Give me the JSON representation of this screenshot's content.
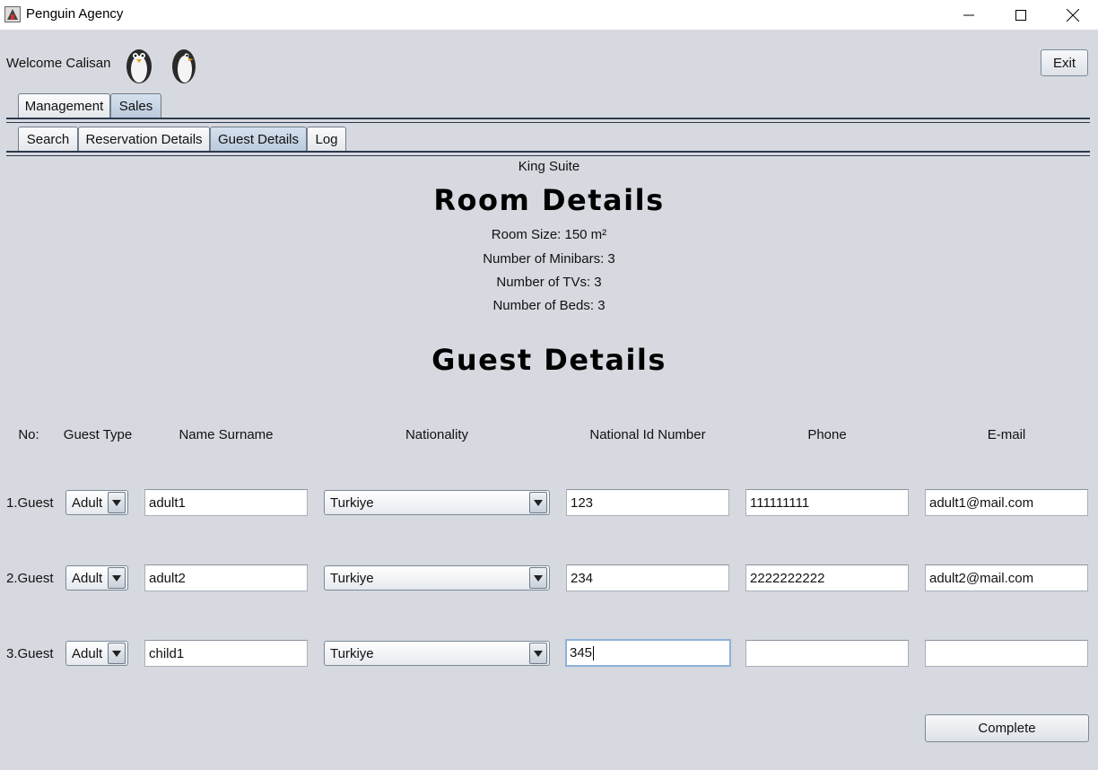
{
  "window": {
    "title": "Penguin Agency",
    "icon": "app-icon"
  },
  "header": {
    "welcome": "Welcome Calisan",
    "exit_label": "Exit"
  },
  "main_tabs": [
    {
      "label": "Management",
      "active": false
    },
    {
      "label": "Sales",
      "active": true
    }
  ],
  "sub_tabs": [
    {
      "label": "Search",
      "active": false
    },
    {
      "label": "Reservation Details",
      "active": false
    },
    {
      "label": "Guest Details",
      "active": true
    },
    {
      "label": "Log",
      "active": false
    }
  ],
  "room": {
    "name": "King Suite",
    "heading": "Room Details",
    "size": "Room Size: 150 m²",
    "minibars": "Number of Minibars: 3",
    "tvs": "Number of TVs: 3",
    "beds": "Number of Beds: 3"
  },
  "guest_section": {
    "heading": "Guest Details",
    "columns": [
      "No:",
      "Guest Type",
      "Name Surname",
      "Nationality",
      "National Id Number",
      "Phone",
      "E-mail"
    ],
    "rows": [
      {
        "label": "1.Guest",
        "type": "Adult",
        "name": "adult1",
        "nationality": "Turkiye",
        "national_id": "123",
        "phone": "111111111",
        "email": "adult1@mail.com"
      },
      {
        "label": "2.Guest",
        "type": "Adult",
        "name": "adult2",
        "nationality": "Turkiye",
        "national_id": "234",
        "phone": "2222222222",
        "email": "adult2@mail.com"
      },
      {
        "label": "3.Guest",
        "type": "Adult",
        "name": "child1",
        "nationality": "Turkiye",
        "national_id": "345",
        "phone": "",
        "email": ""
      }
    ]
  },
  "complete_label": "Complete",
  "colors": {
    "background": "#d6d9df",
    "active_tab": "#c3d1e2",
    "tab_line": "#2b3a4d"
  }
}
